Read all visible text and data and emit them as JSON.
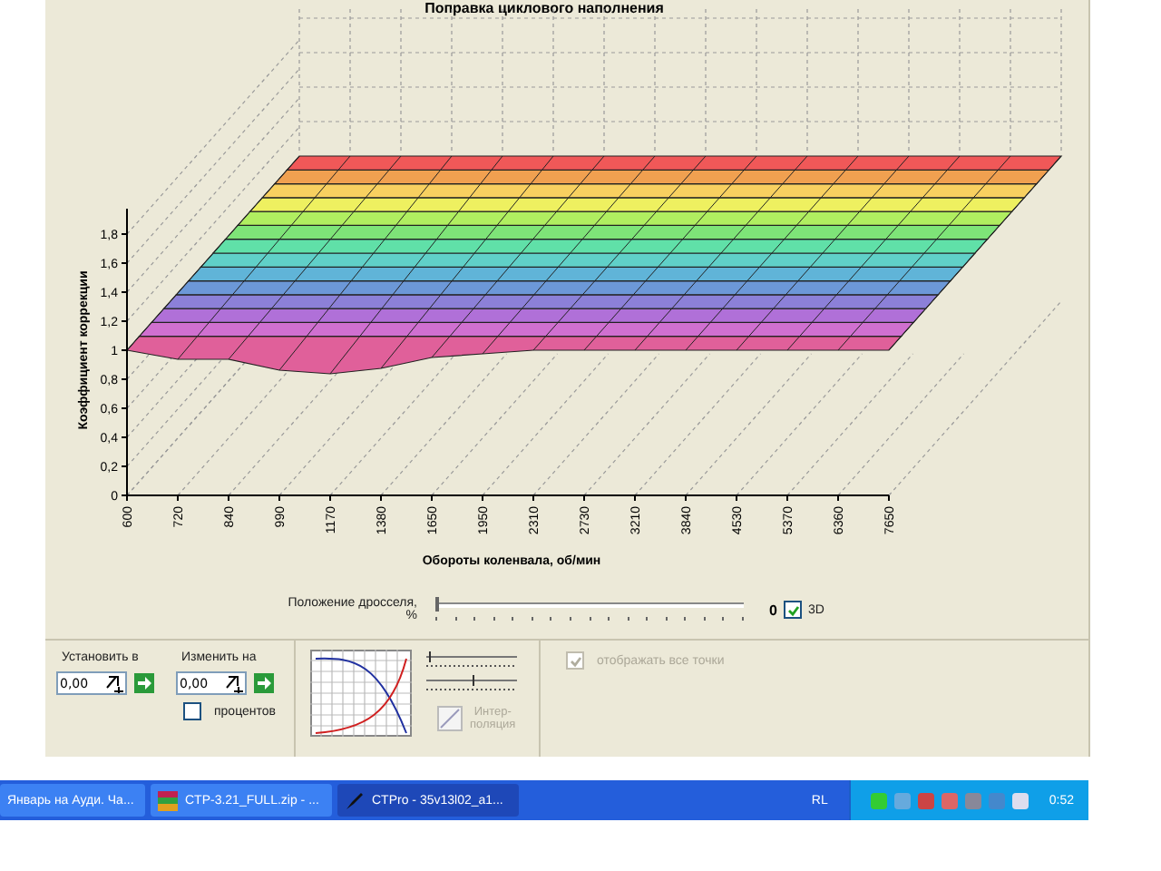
{
  "chart": {
    "title": "Поправка циклового наполнения",
    "ylabel": "Коэффициент коррекции",
    "xlabel": "Обороты коленвала, об/мин",
    "yticks": [
      "1,8",
      "1,6",
      "1,4",
      "1,2",
      "1",
      "0,8",
      "0,6",
      "0,4",
      "0,2",
      "0"
    ],
    "xticks": [
      "600",
      "720",
      "840",
      "990",
      "1170",
      "1380",
      "1650",
      "1950",
      "2310",
      "2730",
      "3210",
      "3840",
      "4530",
      "5370",
      "6360",
      "7650"
    ]
  },
  "throttle": {
    "label": "Положение дросселя,",
    "unit": "%",
    "level": 0,
    "reading": "0",
    "view_3d": {
      "label": "3D",
      "checked": true
    }
  },
  "set_to": {
    "label": "Установить в",
    "value": "0,00"
  },
  "change_by": {
    "label": "Изменить на",
    "value": "0,00",
    "percent": {
      "label": "процентов",
      "checked": false
    }
  },
  "interpolation": {
    "label_lines": [
      "Интер-",
      "поляция"
    ],
    "disabled": true
  },
  "show_all_points": {
    "label": "отображать все точки",
    "checked": true,
    "disabled": true
  },
  "taskbar": {
    "tasks": [
      {
        "label": "Январь на Ауди. Ча...",
        "kind": "none",
        "selected": false
      },
      {
        "label": "CTP-3.21_FULL.zip - ...",
        "kind": "archive",
        "selected": false
      },
      {
        "label": "CTPro - 35v13l02_a1...",
        "kind": "app",
        "selected": true
      }
    ],
    "language": "RL",
    "clock": "0:52"
  }
}
